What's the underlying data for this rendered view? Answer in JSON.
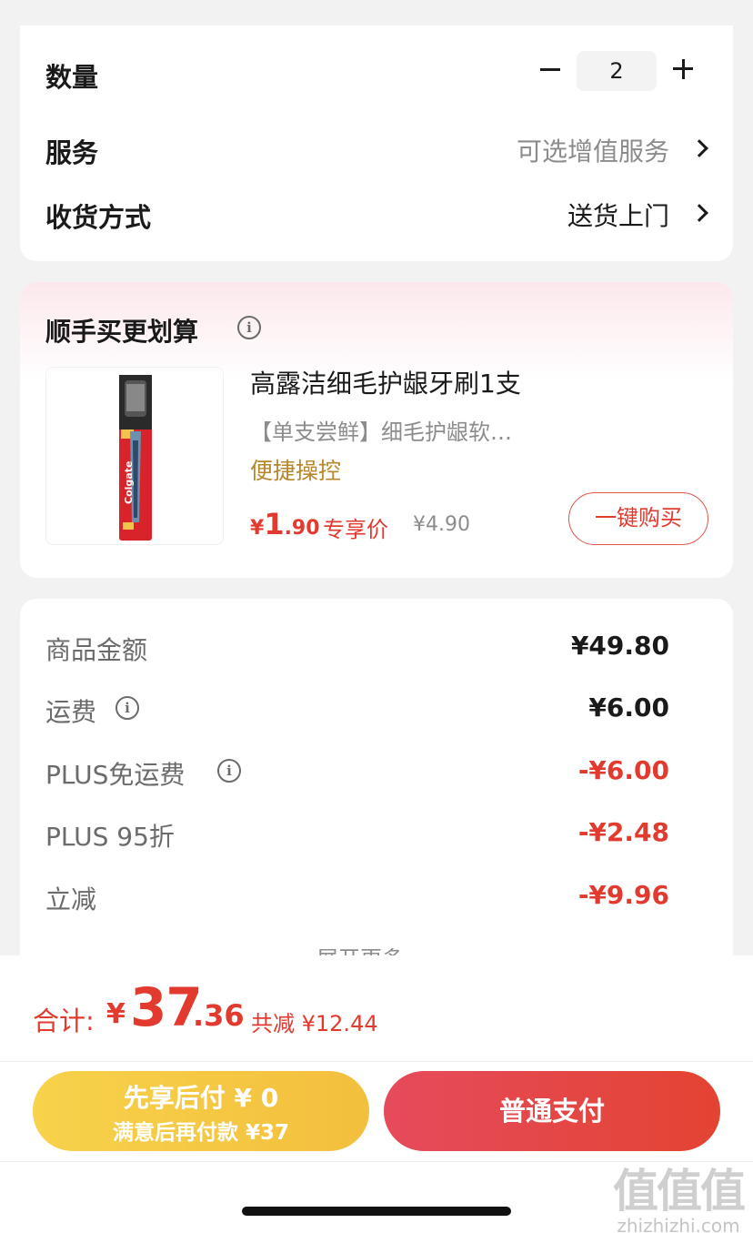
{
  "order": {
    "quantity_label": "数量",
    "quantity_value": "2",
    "service_label": "服务",
    "service_value": "可选增值服务",
    "delivery_label": "收货方式",
    "delivery_value": "送货上门"
  },
  "bundle": {
    "title": "顺手买更划算",
    "info_icon": "i",
    "product": {
      "name": "高露洁细毛护龈牙刷1支",
      "desc": "【单支尝鲜】细毛护龈软…",
      "tag": "便捷操控",
      "price_currency": "¥",
      "price_int": "1",
      "price_dec": ".90",
      "exclusive_label": "专享价",
      "original_price": "¥4.90",
      "buy_button": "一键购买",
      "image_brand": "Colgate"
    }
  },
  "summary": {
    "rows": [
      {
        "label": "商品金额",
        "value": "¥49.80"
      },
      {
        "label": "运费",
        "value": "¥6.00"
      },
      {
        "label": "PLUS免运费",
        "value": "-¥6.00"
      },
      {
        "label": "PLUS 95折",
        "value": "-¥2.48"
      },
      {
        "label": "立减",
        "value": "-¥9.96"
      }
    ],
    "more_label": "展开更多"
  },
  "footer": {
    "total_label": "合计:",
    "total_currency": "¥",
    "total_int": "37",
    "total_dec": ".36",
    "saving": "共减 ¥12.44",
    "pay_later_main": "先享后付 ¥ 0",
    "pay_later_sub": "满意后再付款 ¥37",
    "pay_now": "普通支付"
  },
  "watermark": {
    "big": "值值值",
    "small": "zhizhizhi.com"
  },
  "colors": {
    "accent_red": "#e23a2e",
    "pay_later_yellow": "#f5c842",
    "tag_gold": "#b8862b"
  }
}
